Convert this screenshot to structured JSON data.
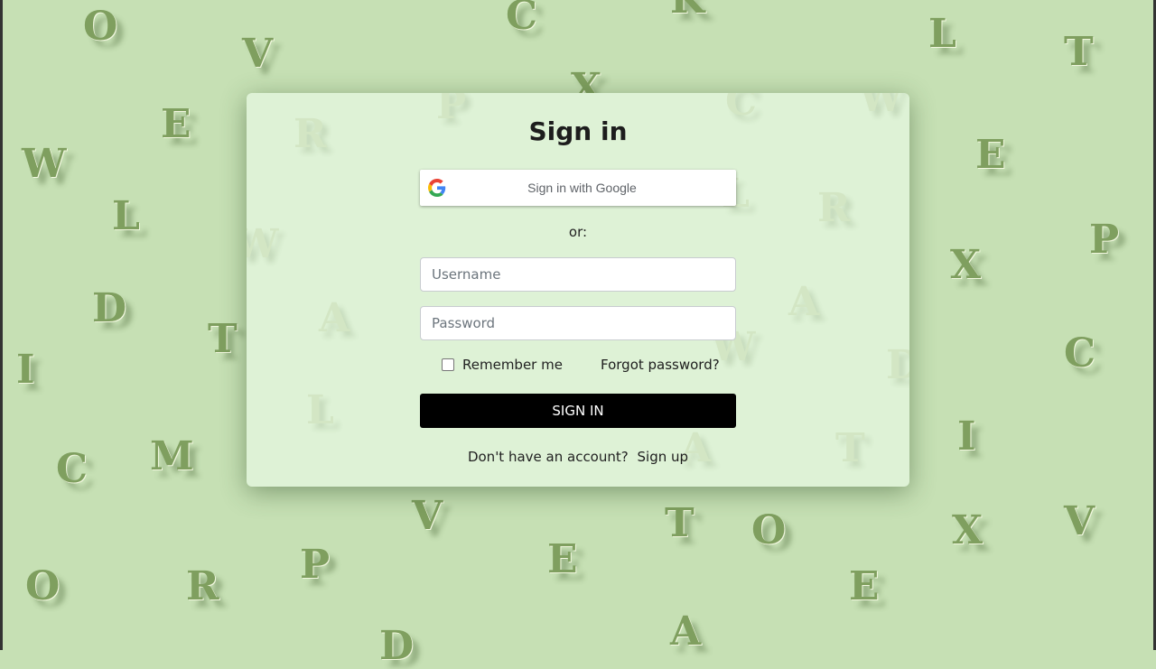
{
  "background_letters": [
    "O",
    "C",
    "K",
    "L",
    "T",
    "V",
    "P",
    "X",
    "C",
    "W",
    "E",
    "W",
    "E",
    "L",
    "W",
    "R",
    "X",
    "P",
    "D",
    "A",
    "A",
    "T",
    "I",
    "D",
    "C",
    "L",
    "I",
    "C",
    "M",
    "L",
    "A",
    "T",
    "V",
    "T",
    "O",
    "X",
    "V",
    "O",
    "R",
    "P",
    "E",
    "E",
    "D",
    "A"
  ],
  "signin": {
    "title": "Sign in",
    "google_label": "Sign in with Google",
    "or_text": "or:",
    "username_placeholder": "Username",
    "password_placeholder": "Password",
    "remember_label": "Remember me",
    "forgot_label": "Forgot password?",
    "submit_label": "SIGN IN",
    "signup_prompt": "Don't have an account?",
    "signup_link": "Sign up"
  },
  "colors": {
    "page_background": "#c6e0b4",
    "card_background": "#def2d6",
    "button_background": "#000000"
  }
}
